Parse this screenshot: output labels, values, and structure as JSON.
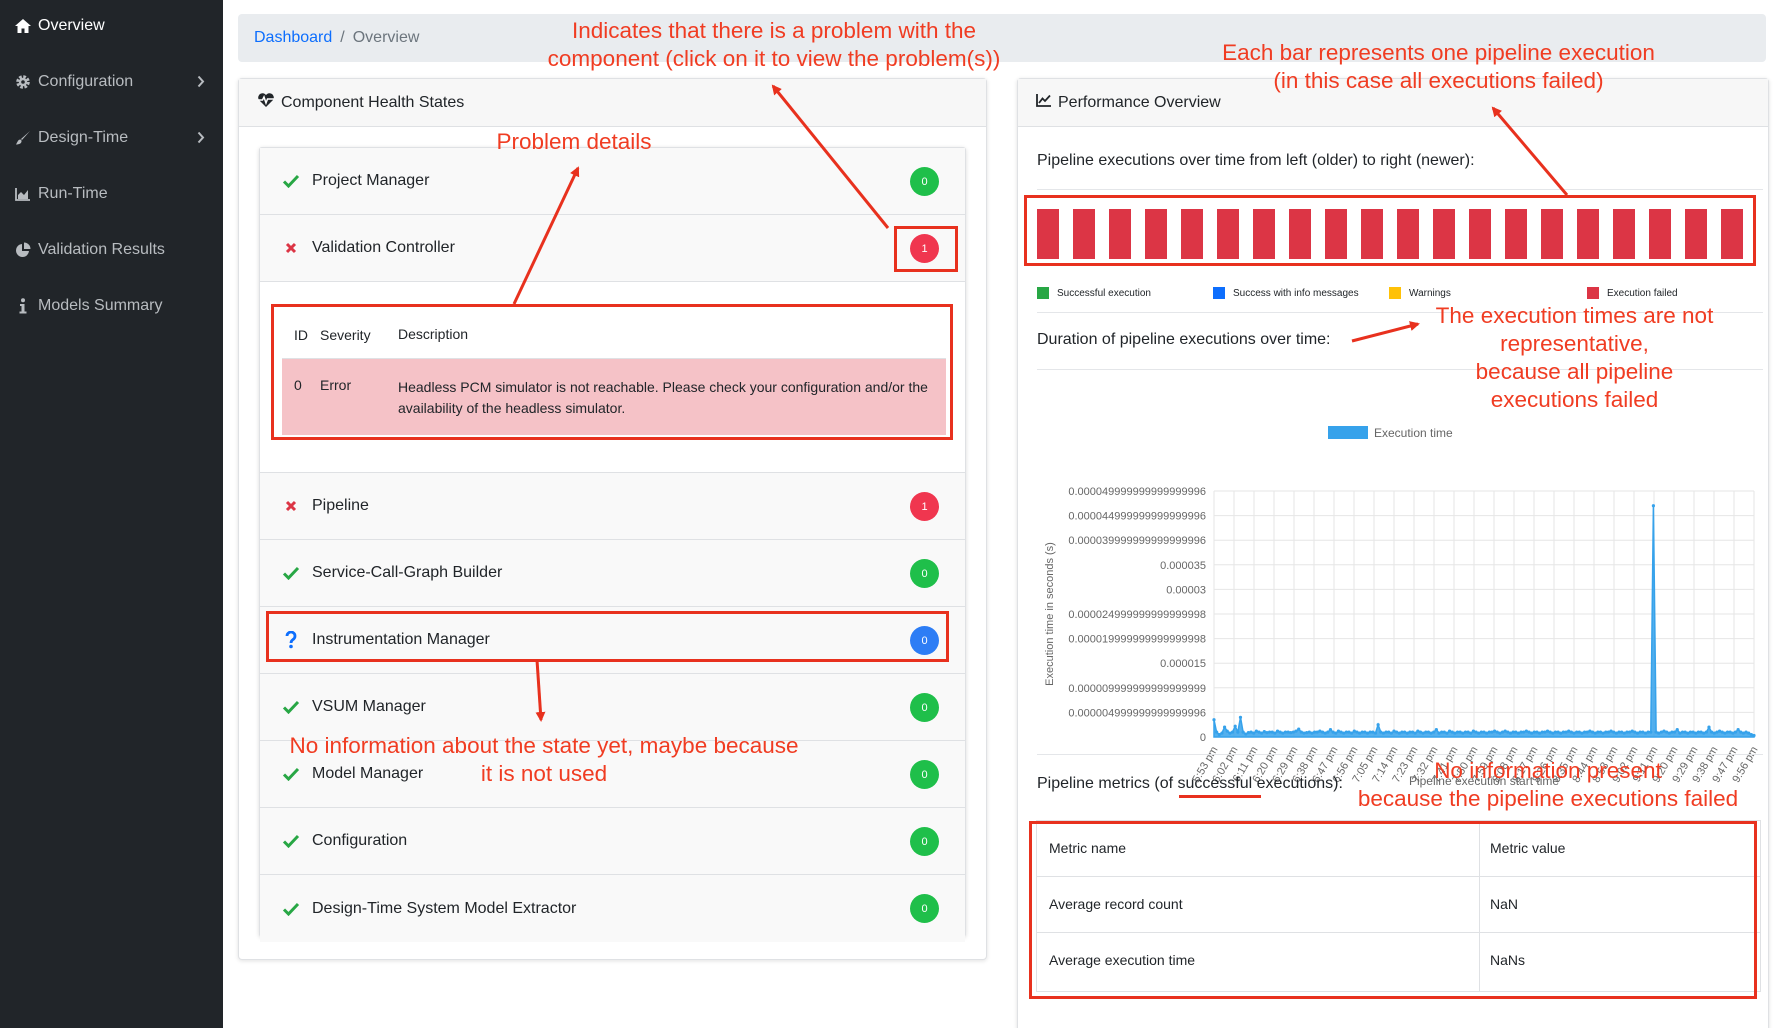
{
  "sidebar": {
    "items": [
      {
        "label": "Overview",
        "icon": "home-icon",
        "has_submenu": false,
        "active": true
      },
      {
        "label": "Configuration",
        "icon": "gear-icon",
        "has_submenu": true,
        "active": false
      },
      {
        "label": "Design-Time",
        "icon": "brush-icon",
        "has_submenu": true,
        "active": false
      },
      {
        "label": "Run-Time",
        "icon": "area-chart-icon",
        "has_submenu": false,
        "active": false
      },
      {
        "label": "Validation Results",
        "icon": "pie-chart-icon",
        "has_submenu": false,
        "active": false
      },
      {
        "label": "Models Summary",
        "icon": "info-icon",
        "has_submenu": false,
        "active": false
      }
    ]
  },
  "breadcrumb": {
    "link": "Dashboard",
    "separator": "/",
    "current": "Overview"
  },
  "health": {
    "title": "Component Health States",
    "title_icon": "heartbeat-icon",
    "components": [
      {
        "name": "Project Manager",
        "state": "ok",
        "count": "0"
      },
      {
        "name": "Validation Controller",
        "state": "error",
        "count": "1"
      },
      {
        "name": "Pipeline",
        "state": "error",
        "count": "1"
      },
      {
        "name": "Service-Call-Graph Builder",
        "state": "ok",
        "count": "0"
      },
      {
        "name": "Instrumentation Manager",
        "state": "unknown",
        "count": "0"
      },
      {
        "name": "VSUM Manager",
        "state": "ok",
        "count": "0"
      },
      {
        "name": "Model Manager",
        "state": "ok",
        "count": "0"
      },
      {
        "name": "Configuration",
        "state": "ok",
        "count": "0"
      },
      {
        "name": "Design-Time System Model Extractor",
        "state": "ok",
        "count": "0"
      }
    ],
    "problems": {
      "headers": [
        "ID",
        "Severity",
        "Description"
      ],
      "rows": [
        {
          "id": "0",
          "severity": "Error",
          "description": "Headless PCM simulator is not reachable. Please check your configuration and/or the availability of the headless simulator."
        }
      ]
    }
  },
  "performance": {
    "title": "Performance Overview",
    "title_icon": "line-chart-icon",
    "executions_label": "Pipeline executions over time from left (older) to right (newer):",
    "execution_count": 20,
    "execution_status_color": "#dc3545",
    "legend": [
      {
        "label": "Successful execution",
        "color": "#28a745"
      },
      {
        "label": "Success with info messages",
        "color": "#0d6efd"
      },
      {
        "label": "Warnings",
        "color": "#ffc107"
      },
      {
        "label": "Execution failed",
        "color": "#dc3545"
      }
    ],
    "duration_label": "Duration of pipeline executions over time:",
    "metrics_label_pre": "Pipeline metrics (of ",
    "metrics_label_em": "successful",
    "metrics_label_post": " executions):",
    "metrics": {
      "headers": [
        "Metric name",
        "Metric value"
      ],
      "rows": [
        {
          "name": "Average record count",
          "value": "NaN"
        },
        {
          "name": "Average execution time",
          "value": "NaNs"
        }
      ]
    }
  },
  "chart_data": {
    "type": "area",
    "series": [
      {
        "name": "Execution time",
        "color": "#36a2eb",
        "values": [
          3.5e-06,
          1e-06,
          5e-07,
          8e-07,
          2e-06,
          1.2e-06,
          8e-07,
          1e-06,
          2.2e-06,
          1e-06,
          4e-06,
          1e-06,
          6e-07,
          9e-07,
          1e-06,
          8e-07,
          1.2e-06,
          1e-06,
          8e-07,
          1.1e-06,
          9e-07,
          1e-06,
          1e-06,
          8e-07,
          1.2e-06,
          1e-06,
          8e-07,
          1e-06,
          1e-06,
          9e-07,
          1e-06,
          1.2e-06,
          1.6e-06,
          1e-06,
          8e-07,
          9e-07,
          1e-06,
          8e-07,
          1e-06,
          1e-06,
          1.2e-06,
          1e-06,
          8e-07,
          1e-06,
          1.5e-06,
          1e-06,
          8e-07,
          1.2e-06,
          1e-06,
          8e-07,
          1e-06,
          1e-06,
          8e-07,
          1.2e-06,
          1e-06,
          8e-07,
          1e-06,
          1e-06,
          8e-07,
          1e-06,
          1e-06,
          8e-07,
          2.5e-06,
          1e-06,
          8e-07,
          1e-06,
          1e-06,
          8e-07,
          1.2e-06,
          1e-06,
          8e-07,
          1e-06,
          1e-06,
          8e-07,
          1e-06,
          1e-06,
          8e-07,
          1.2e-06,
          1e-06,
          8e-07,
          1e-06,
          1e-06,
          8e-07,
          1e-06,
          1.5e-06,
          8e-07,
          1e-06,
          1e-06,
          8e-07,
          1.2e-06,
          1e-06,
          8e-07,
          1e-06,
          1e-06,
          8e-07,
          1e-06,
          1e-06,
          8e-07,
          1.2e-06,
          1e-06,
          8e-07,
          1e-06,
          1e-06,
          8e-07,
          1e-06,
          1e-06,
          1.2e-06,
          1e-06,
          8e-07,
          1e-06,
          1.2e-06,
          1e-06,
          8e-07,
          1e-06,
          1e-06,
          8e-07,
          1e-06,
          1e-06,
          1.2e-06,
          1e-06,
          8e-07,
          1e-06,
          1e-06,
          8e-07,
          1e-06,
          1e-06,
          1.2e-06,
          1e-06,
          8e-07,
          1e-06,
          1e-06,
          8e-07,
          1e-06,
          1e-06,
          1.2e-06,
          1e-06,
          8e-07,
          1e-06,
          1e-06,
          8e-07,
          1e-06,
          1e-06,
          1.2e-06,
          1e-06,
          8e-07,
          1e-06,
          1e-06,
          8e-07,
          1e-06,
          1e-06,
          1.2e-06,
          1e-06,
          8e-07,
          1e-06,
          1e-06,
          8e-07,
          1e-06,
          1e-06,
          1.2e-06,
          1e-06,
          8e-07,
          1e-06,
          1e-06,
          8e-07,
          1e-06,
          1e-06,
          4.7e-05,
          1e-06,
          8e-07,
          1e-06,
          1.2e-06,
          1e-06,
          8e-07,
          1e-06,
          1e-06,
          1.5e-06,
          8e-07,
          1e-06,
          1e-06,
          8e-07,
          1e-06,
          1e-06,
          8e-07,
          1e-06,
          1e-06,
          8e-07,
          1e-06,
          2e-06,
          1e-06,
          8e-07,
          1e-06,
          1.2e-06,
          1e-06,
          8e-07,
          1e-06,
          1e-06,
          8e-07,
          1e-06,
          1.5e-06,
          1e-06,
          8e-07,
          1e-06,
          8e-07,
          5e-07,
          3e-07
        ]
      }
    ],
    "x_tick_labels": [
      "5:53 pm",
      "6:02 pm",
      "6:11 pm",
      "6:20 pm",
      "6:29 pm",
      "6:38 pm",
      "6:47 pm",
      "6:56 pm",
      "7:05 pm",
      "7:14 pm",
      "7:23 pm",
      "7:32 pm",
      "7:41 pm",
      "7:50 pm",
      "7:59 pm",
      "8:08 pm",
      "8:17 pm",
      "8:26 pm",
      "8:35 pm",
      "8:44 pm",
      "8:53 pm",
      "9:02 pm",
      "9:11 pm",
      "9:20 pm",
      "9:29 pm",
      "9:38 pm",
      "9:47 pm",
      "9:56 pm"
    ],
    "y_tick_labels": [
      "0",
      "0.000004999999999999996",
      "0.000009999999999999999",
      "0.000015",
      "0.000019999999999999998",
      "0.000024999999999999998",
      "0.00003",
      "0.000035",
      "0.000039999999999999996",
      "0.000044999999999999996",
      "0.000049999999999999996"
    ],
    "ylim": [
      0,
      5e-05
    ],
    "xlabel": "Pipeline execution start time",
    "ylabel": "Execution time in seconds (s)",
    "legend_label": "Execution time",
    "legend_position": "top",
    "grid": true
  },
  "annotations": {
    "top_center": [
      "Indicates that there is a problem with the",
      "component (click on it to view the problem(s))"
    ],
    "problem_details": "Problem details",
    "bars_note": [
      "Each bar represents one pipeline execution",
      "(in this case all executions failed)"
    ],
    "times_note": [
      "The execution times are not",
      "representative,",
      "because all pipeline",
      "executions failed"
    ],
    "no_info_state": [
      "No information about the state yet, maybe because",
      "it is not used"
    ],
    "no_metrics": [
      "No information present",
      "because the pipeline executions failed"
    ],
    "color": "#f03c22"
  }
}
